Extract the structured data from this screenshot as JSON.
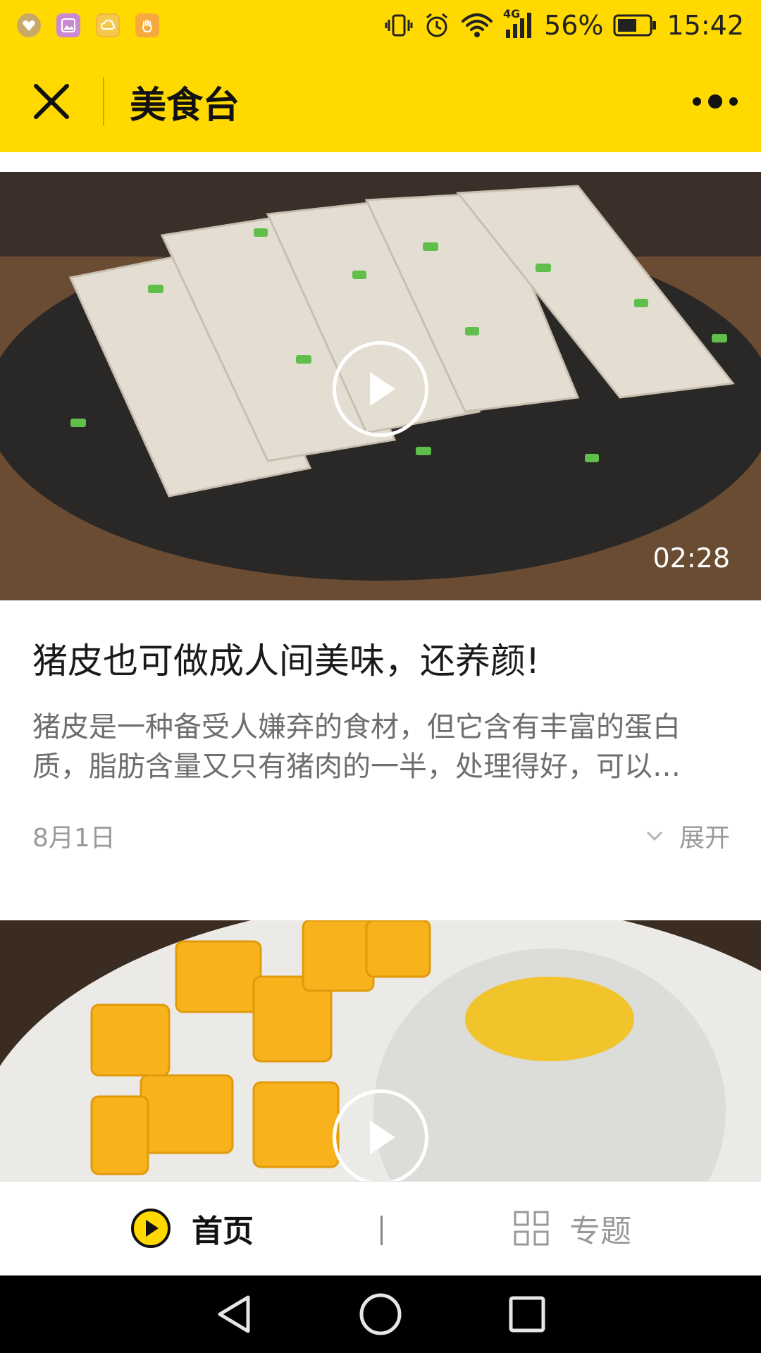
{
  "status_bar": {
    "network": "4G",
    "battery": "56%",
    "time": "15:42",
    "icons": [
      "vibrate-icon",
      "alarm-icon",
      "wifi-icon",
      "cellular-signal-icon",
      "battery-icon"
    ]
  },
  "app_bar": {
    "title": "美食台",
    "close_icon": "close-icon",
    "more_icon": "more-icon"
  },
  "feed": {
    "posts": [
      {
        "duration": "02:28",
        "title": "猪皮也可做成人间美味，还养颜!",
        "summary": "猪皮是一种备受人嫌弃的食材，但它含有丰富的蛋白质，脂肪含量又只有猪肉的一半，处理得好，可以…",
        "date": "8月1日",
        "expand_label": "展开"
      }
    ]
  },
  "tabs": {
    "home_label": "首页",
    "topics_label": "专题",
    "selected": "首页"
  },
  "colors": {
    "brand_yellow": "#FFD900",
    "title_text": "#1a1a1a",
    "summary_text": "#6e6e6e",
    "meta_text": "#9a9a9a"
  }
}
